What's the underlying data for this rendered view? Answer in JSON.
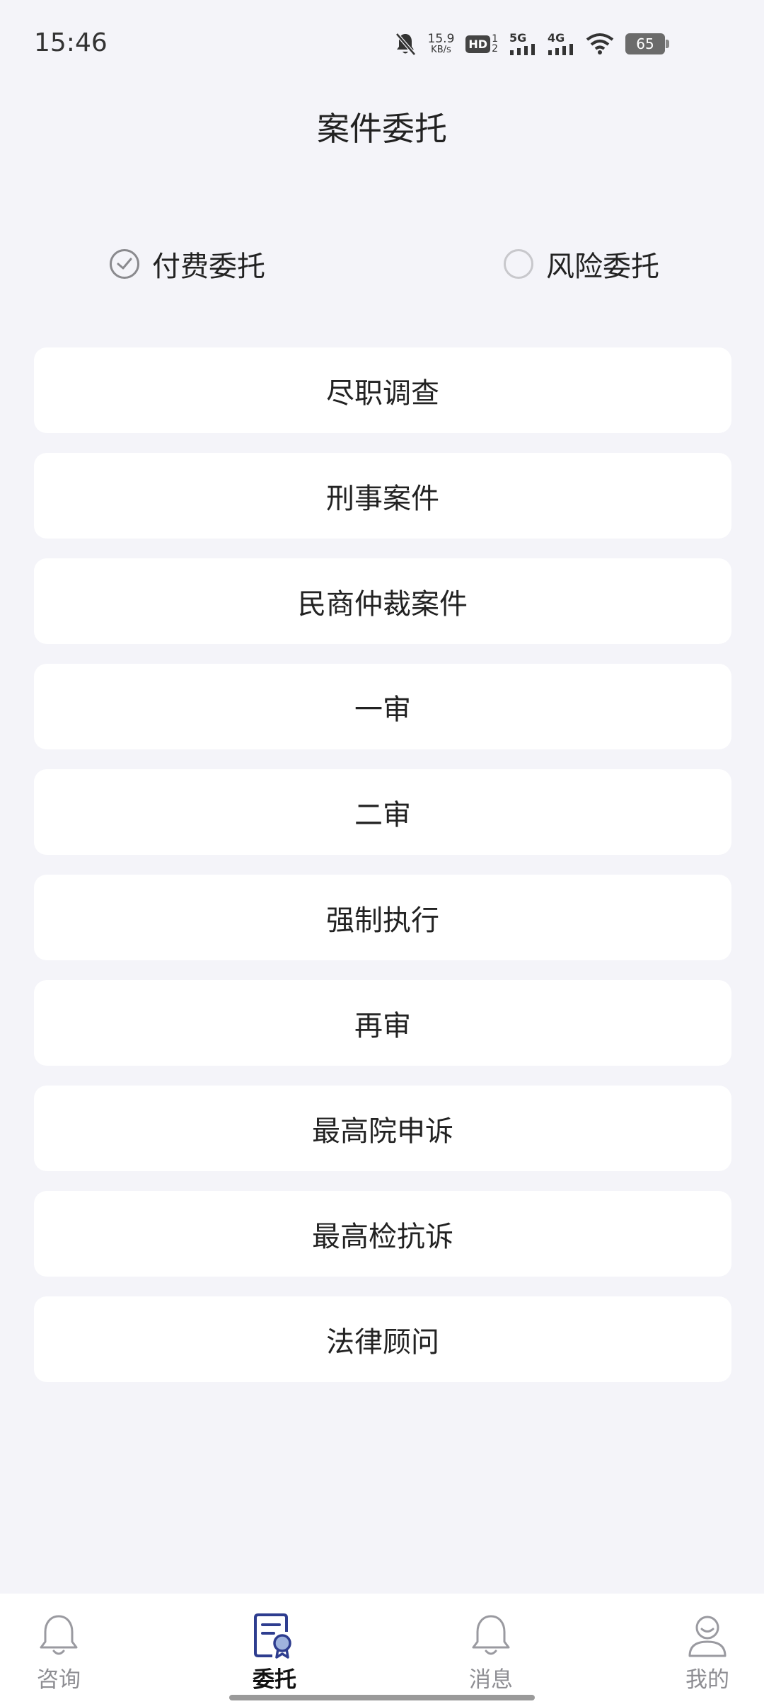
{
  "status_bar": {
    "time": "15:46",
    "net_speed_value": "15.9",
    "net_speed_unit": "KB/s",
    "hd_label": "HD",
    "hd_sub_top": "1",
    "hd_sub_bottom": "2",
    "net1_label": "5G",
    "net2_label": "4G",
    "battery": "65",
    "icons": [
      "mute-bell-icon",
      "signal-icon",
      "wifi-icon",
      "battery-icon"
    ]
  },
  "header": {
    "title": "案件委托"
  },
  "entrust_type": {
    "options": [
      {
        "label": "付费委托",
        "selected": true
      },
      {
        "label": "风险委托",
        "selected": false
      }
    ]
  },
  "case_types": [
    "尽职调查",
    "刑事案件",
    "民商仲裁案件",
    "一审",
    "二审",
    "强制执行",
    "再审",
    "最高院申诉",
    "最高检抗诉",
    "法律顾问"
  ],
  "bottom_nav": {
    "items": [
      {
        "label": "咨询",
        "icon": "bell-icon",
        "active": false
      },
      {
        "label": "委托",
        "icon": "document-award-icon",
        "active": true
      },
      {
        "label": "消息",
        "icon": "bell-icon",
        "active": false
      },
      {
        "label": "我的",
        "icon": "user-icon",
        "active": false
      }
    ]
  },
  "colors": {
    "background": "#f4f4f9",
    "card": "#ffffff",
    "active_icon": "#2e3d8f",
    "active_icon_accent": "#9fb3dd",
    "inactive": "#8e8e93"
  }
}
